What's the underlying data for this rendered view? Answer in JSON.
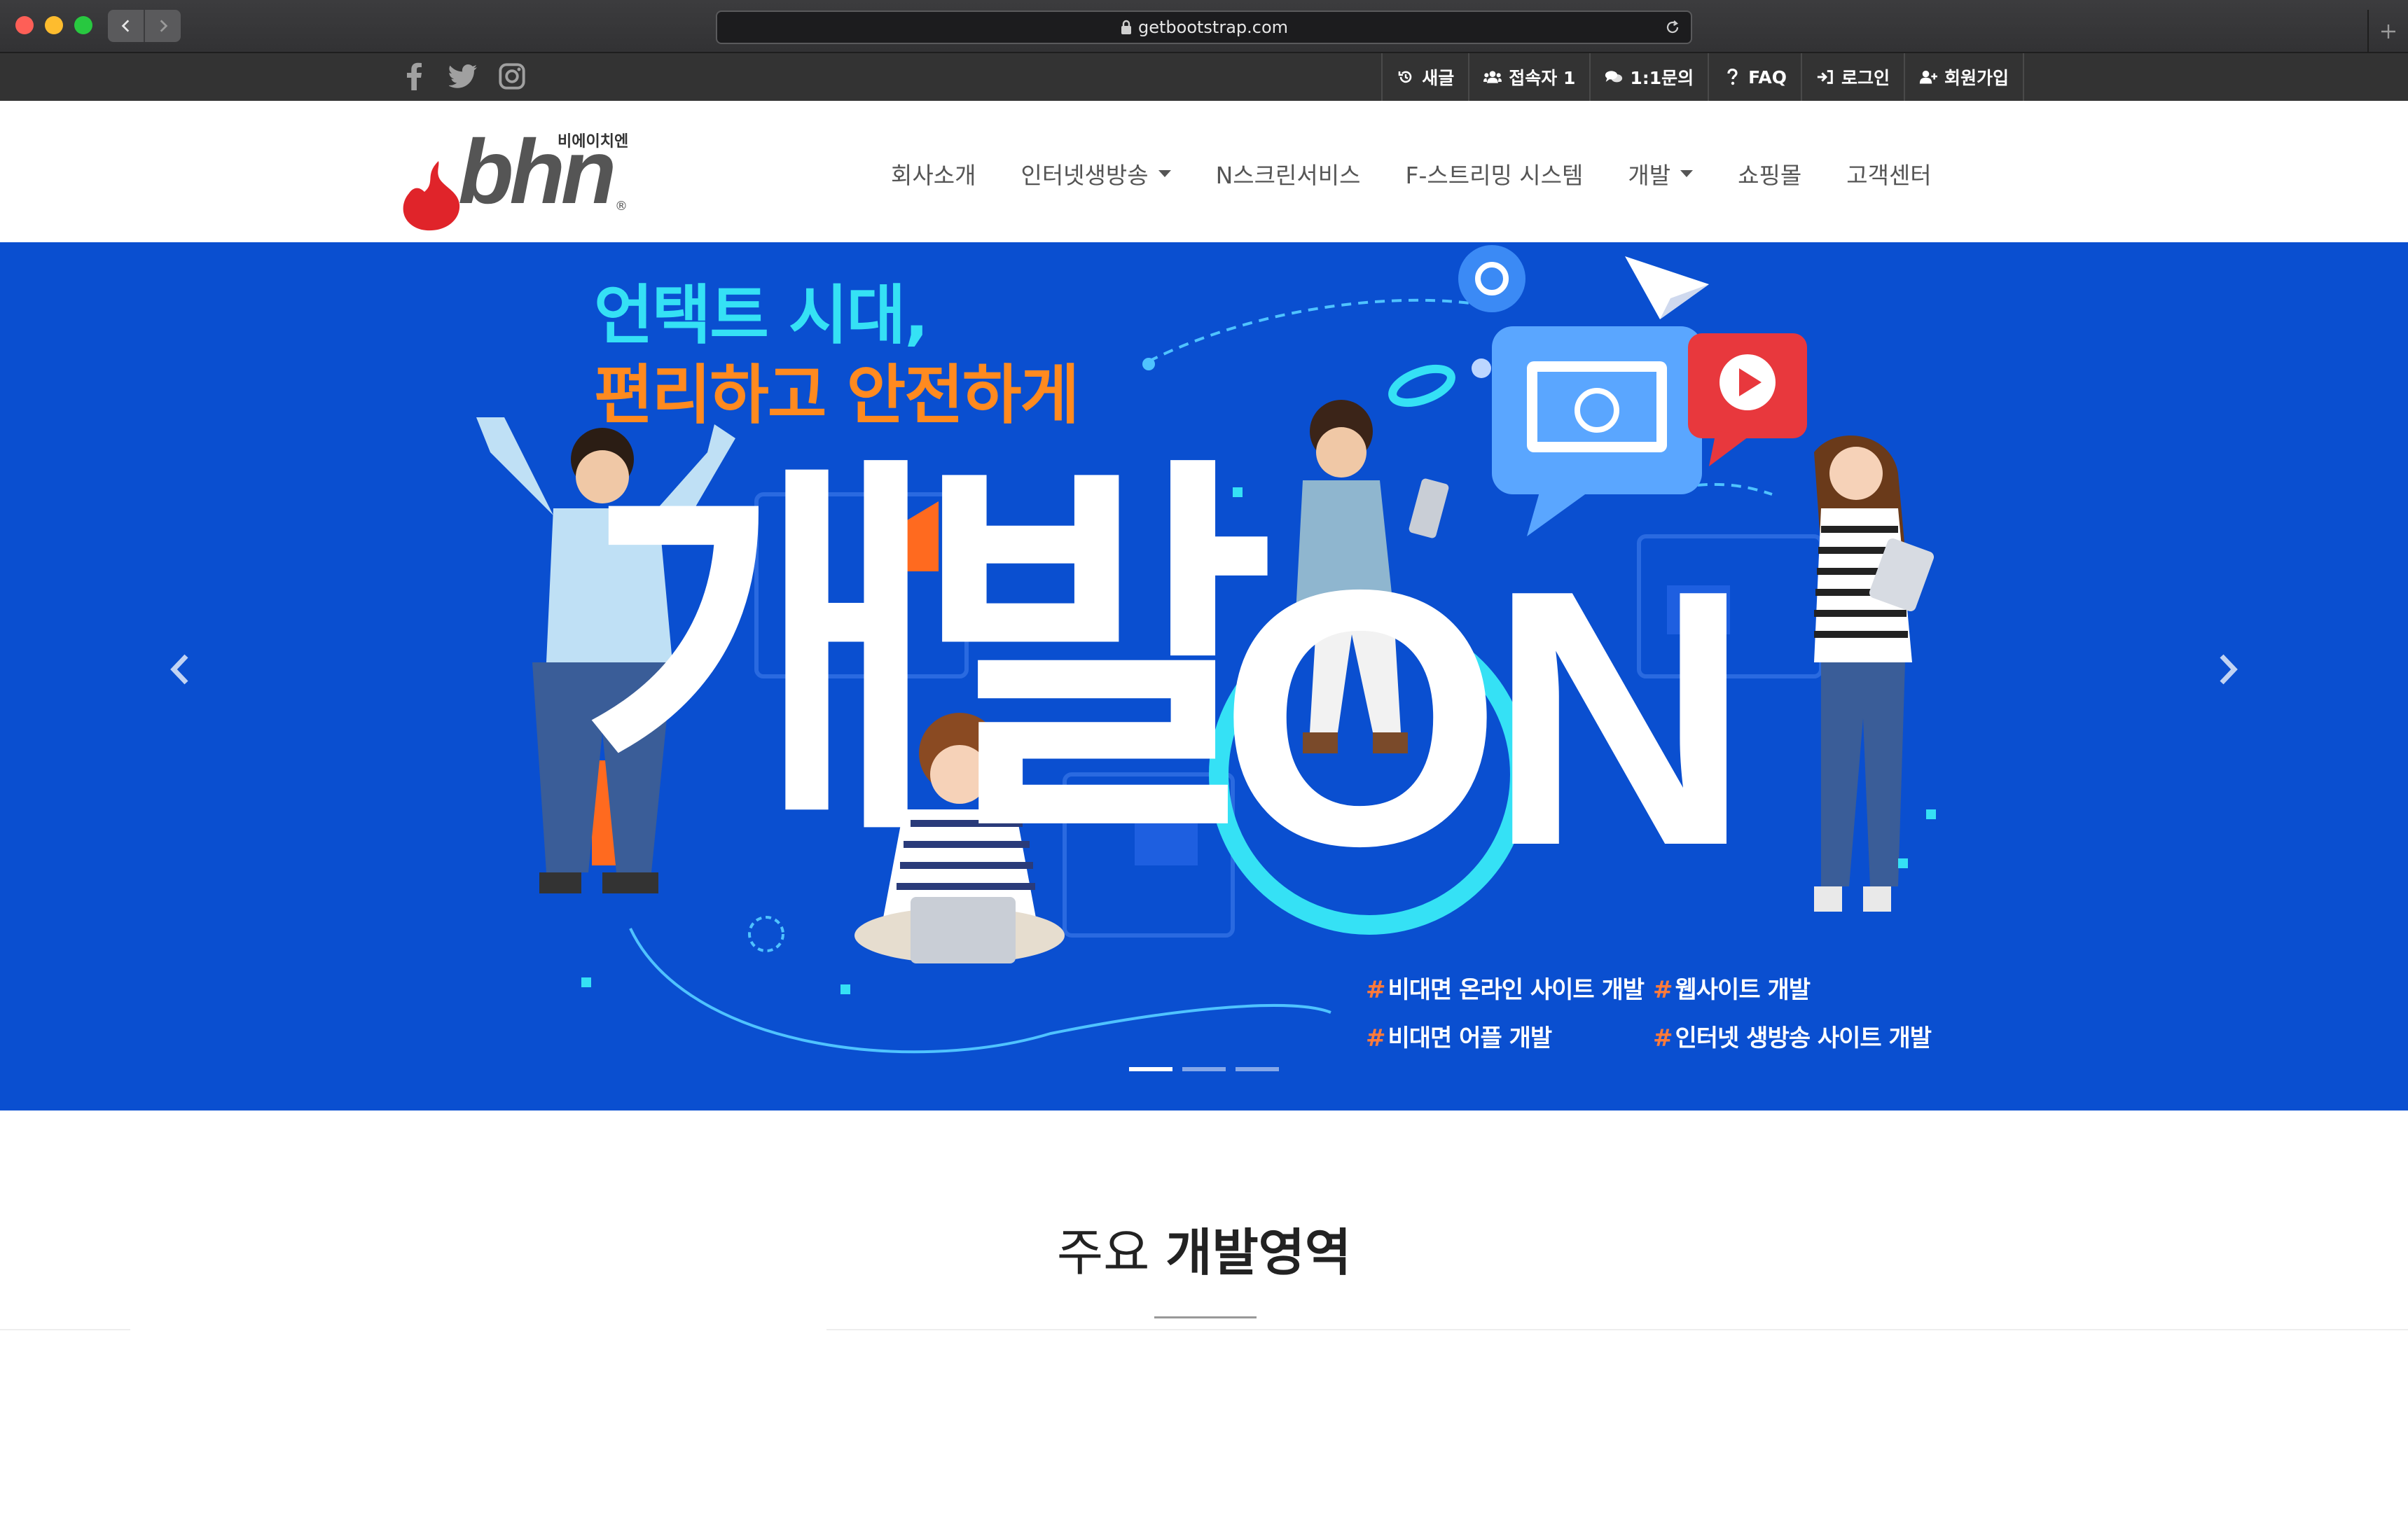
{
  "browser": {
    "url": "getbootstrap.com"
  },
  "topbar": {
    "social_icons": [
      "facebook-icon",
      "twitter-icon",
      "instagram-icon"
    ],
    "items": [
      {
        "icon": "history-icon",
        "label": "새글"
      },
      {
        "icon": "users-icon",
        "label": "접속자 1"
      },
      {
        "icon": "comments-icon",
        "label": "1:1문의"
      },
      {
        "icon": "question-icon",
        "label": "FAQ"
      },
      {
        "icon": "sign-in-icon",
        "label": "로그인"
      },
      {
        "icon": "user-plus-icon",
        "label": "회원가입"
      }
    ]
  },
  "header": {
    "logo_text": "bhn",
    "logo_sub": "비에이치엔",
    "logo_reg": "®",
    "nav": [
      {
        "label": "회사소개",
        "dropdown": false
      },
      {
        "label": "인터넷생방송",
        "dropdown": true
      },
      {
        "label": "N스크린서비스",
        "dropdown": false
      },
      {
        "label": "F-스트리밍 시스템",
        "dropdown": false
      },
      {
        "label": "개발",
        "dropdown": true
      },
      {
        "label": "쇼핑몰",
        "dropdown": false
      },
      {
        "label": "고객센터",
        "dropdown": false
      }
    ]
  },
  "hero": {
    "headline1": "언택트 시대,",
    "headline2": "편리하고 안전하게",
    "big_word": "개발",
    "big_on": "ON",
    "tags": [
      {
        "hash": "#",
        "text": "비대면 온라인 사이트 개발"
      },
      {
        "hash": "#",
        "text": "웹사이트 개발"
      },
      {
        "hash": "#",
        "text": "비대면 어플 개발"
      },
      {
        "hash": "#",
        "text": "인터넷 생방송 사이트 개발"
      }
    ],
    "slides_total": 3,
    "active_slide": 1,
    "colors": {
      "background": "#0a4fd0",
      "accent_cyan": "#35e1f5",
      "accent_orange": "#ff8a1f"
    }
  },
  "section": {
    "title_light": "주요",
    "title_bold": "개발영역"
  }
}
